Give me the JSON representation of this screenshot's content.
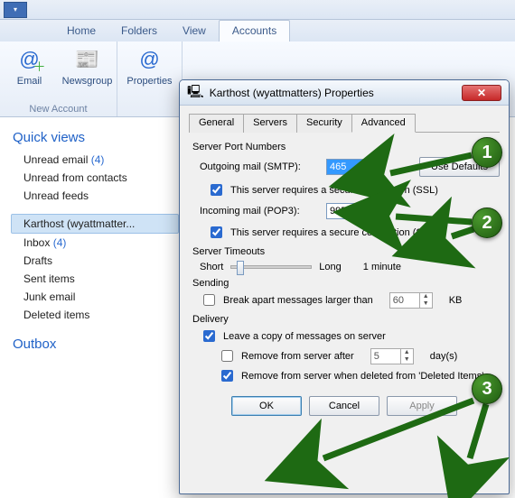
{
  "qat": {},
  "ribbon": {
    "tabs": {
      "home": "Home",
      "folders": "Folders",
      "view": "View",
      "accounts": "Accounts"
    },
    "buttons": {
      "email": "Email",
      "newsgroup": "Newsgroup",
      "properties": "Properties"
    },
    "group_new": "New Account"
  },
  "sidebar": {
    "quickviews": "Quick views",
    "unread_email": "Unread email",
    "unread_email_count": "(4)",
    "unread_contacts": "Unread from contacts",
    "unread_feeds": "Unread feeds",
    "account_name": "Karthost (wyattmatter...",
    "inbox": "Inbox",
    "inbox_count": "(4)",
    "drafts": "Drafts",
    "sent": "Sent items",
    "junk": "Junk email",
    "deleted": "Deleted items",
    "outbox": "Outbox"
  },
  "dialog": {
    "title": "Karthost (wyattmatters) Properties",
    "tabs": {
      "general": "General",
      "servers": "Servers",
      "security": "Security",
      "advanced": "Advanced"
    },
    "spn": {
      "legend": "Server Port Numbers",
      "smtp_label": "Outgoing mail (SMTP):",
      "smtp_value": "465",
      "use_defaults": "Use Defaults",
      "smtp_ssl": "This server requires a secure connection (SSL)",
      "pop_label": "Incoming mail (POP3):",
      "pop_value": "995",
      "pop_ssl": "This server requires a secure connection (SSL)"
    },
    "timeouts": {
      "legend": "Server Timeouts",
      "short": "Short",
      "long": "Long",
      "value": "1 minute"
    },
    "sending": {
      "legend": "Sending",
      "break_label": "Break apart messages larger than",
      "break_value": "60",
      "kb": "KB"
    },
    "delivery": {
      "legend": "Delivery",
      "leave": "Leave a copy of messages on server",
      "remove_after": "Remove from server after",
      "remove_after_value": "5",
      "days": "day(s)",
      "remove_deleted": "Remove from server when deleted from 'Deleted Items'"
    },
    "buttons": {
      "ok": "OK",
      "cancel": "Cancel",
      "apply": "Apply"
    }
  },
  "callouts": {
    "c1": "1",
    "c2": "2",
    "c3": "3"
  }
}
